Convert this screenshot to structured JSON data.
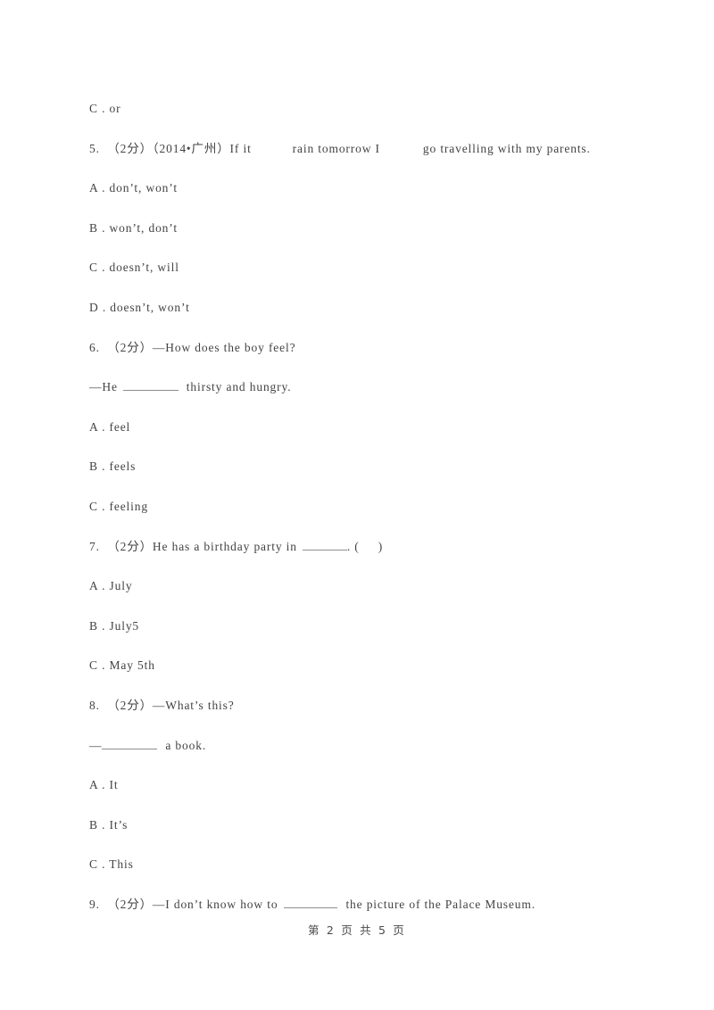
{
  "document": {
    "page_footer": "第 2 页 共 5 页",
    "text_color": "#434343",
    "background_color": "#ffffff",
    "blank_rule_color": "#8e8e8e"
  },
  "body_lines": [
    {
      "id": "opt-4-c",
      "kind": "option",
      "text": "C . or"
    },
    {
      "id": "q5-stem",
      "kind": "question",
      "number": "5.",
      "marks": "（2分）",
      "source": "（2014•广州）",
      "text": "5.  （2分）（2014•广州）If it        rain tomorrow I        go travelling with my parents."
    },
    {
      "id": "opt-5-a",
      "kind": "option",
      "text": "A . don’t, won’t"
    },
    {
      "id": "opt-5-b",
      "kind": "option",
      "text": "B . won’t, don’t"
    },
    {
      "id": "opt-5-c",
      "kind": "option",
      "text": "C . doesn’t, will"
    },
    {
      "id": "opt-5-d",
      "kind": "option",
      "text": "D . doesn’t, won’t"
    },
    {
      "id": "q6-stem",
      "kind": "question",
      "number": "6.",
      "marks": "（2分）",
      "text": "6.  （2分）—How does the boy feel?"
    },
    {
      "id": "q6-stem-2",
      "kind": "question-cont",
      "text_before": "—He ",
      "blank": true,
      "text_after": " thirsty and hungry."
    },
    {
      "id": "opt-6-a",
      "kind": "option",
      "text": "A . feel"
    },
    {
      "id": "opt-6-b",
      "kind": "option",
      "text": "B . feels"
    },
    {
      "id": "opt-6-c",
      "kind": "option",
      "text": "C . feeling"
    },
    {
      "id": "q7-stem",
      "kind": "question",
      "number": "7.",
      "marks": "（2分）",
      "text_before": "7.  （2分）He has a birthday party in ",
      "blank": true,
      "text_after": ". (     )"
    },
    {
      "id": "opt-7-a",
      "kind": "option",
      "text": "A . July"
    },
    {
      "id": "opt-7-b",
      "kind": "option",
      "text": "B . July5"
    },
    {
      "id": "opt-7-c",
      "kind": "option",
      "text": "C . May 5th"
    },
    {
      "id": "q8-stem",
      "kind": "question",
      "number": "8.",
      "marks": "（2分）",
      "text": "8.  （2分）—What’s this?"
    },
    {
      "id": "q8-stem-2",
      "kind": "question-cont",
      "text_before": "—",
      "blank": true,
      "text_after": " a book."
    },
    {
      "id": "opt-8-a",
      "kind": "option",
      "text": "A . It"
    },
    {
      "id": "opt-8-b",
      "kind": "option",
      "text": "B . It’s"
    },
    {
      "id": "opt-8-c",
      "kind": "option",
      "text": "C . This"
    },
    {
      "id": "q9-stem",
      "kind": "question",
      "number": "9.",
      "marks": "（2分）",
      "text_before": "9.  （2分）—I don’t know how to ",
      "blank": true,
      "text_after": " the picture of the Palace Museum."
    }
  ],
  "lines": {
    "l0": "C . or",
    "l1_a": "5.  （2分）（2014•广州）If it",
    "l1_b": "rain tomorrow I",
    "l1_c": "go travelling with my parents.",
    "l2": "A . don’t, won’t",
    "l3": "B . won’t, don’t",
    "l4": "C . doesn’t, will",
    "l5": "D . doesn’t, won’t",
    "l6": "6.  （2分）—How does the boy feel?",
    "l7_a": "—He",
    "l7_b": "thirsty and hungry.",
    "l8": "A . feel",
    "l9": "B . feels",
    "l10": "C . feeling",
    "l11_a": "7.  （2分）He has a birthday party in",
    "l11_b": ". (     )",
    "l12": "A . July",
    "l13": "B . July5",
    "l14": "C . May 5th",
    "l15": "8.  （2分）—What’s this?",
    "l16_a": "—",
    "l16_b": "a book.",
    "l17": "A . It",
    "l18": "B . It’s",
    "l19": "C . This",
    "l20_a": "9.  （2分）—I don’t know how to",
    "l20_b": "the picture of the Palace Museum."
  }
}
